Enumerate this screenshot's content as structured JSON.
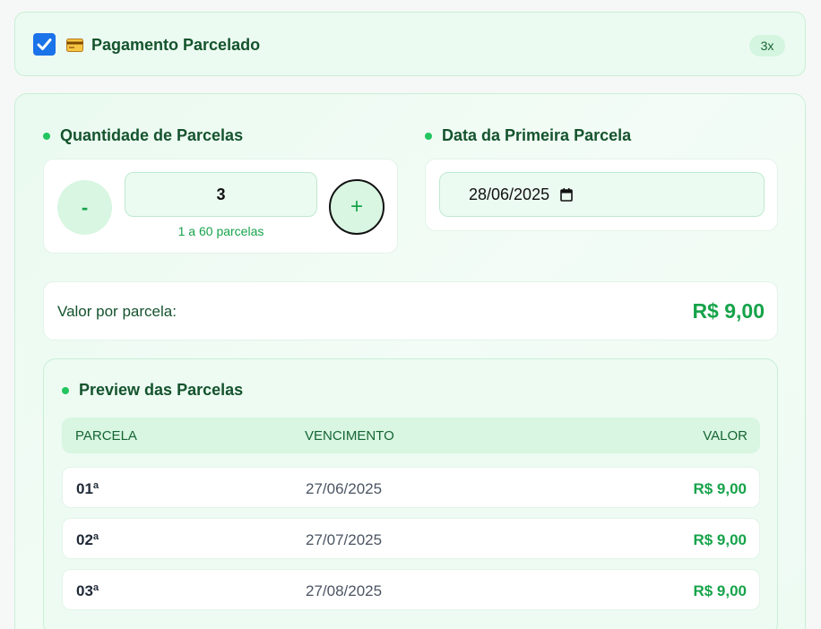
{
  "header": {
    "checkbox_checked": true,
    "card_icon": "credit-card-icon",
    "title": "Pagamento Parcelado",
    "badge": "3x"
  },
  "quantity": {
    "label": "Quantidade de Parcelas",
    "minus_label": "-",
    "value": "3",
    "plus_label": "+",
    "hint": "1 a 60 parcelas"
  },
  "first_date": {
    "label": "Data da Primeira Parcela",
    "value": "28/06/2025",
    "icon": "calendar-icon"
  },
  "per_installment": {
    "label": "Valor por parcela:",
    "amount": "R$ 9,00"
  },
  "preview": {
    "title": "Preview das Parcelas",
    "columns": [
      "PARCELA",
      "VENCIMENTO",
      "VALOR"
    ],
    "rows": [
      {
        "parcela": "01ª",
        "vencimento": "27/06/2025",
        "valor": "R$ 9,00"
      },
      {
        "parcela": "02ª",
        "vencimento": "27/07/2025",
        "valor": "R$ 9,00"
      },
      {
        "parcela": "03ª",
        "vencimento": "27/08/2025",
        "valor": "R$ 9,00"
      }
    ]
  },
  "colors": {
    "accent": "#16a34a",
    "dot": "#22c55e",
    "checkbox": "#1a73e8"
  }
}
